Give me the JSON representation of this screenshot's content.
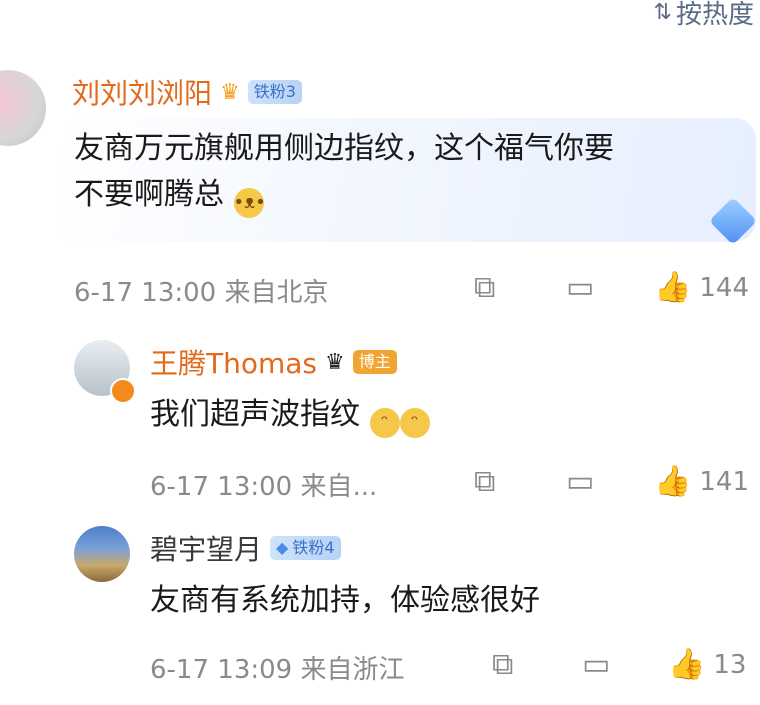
{
  "sort": {
    "icon": "sort-icon",
    "label": "按热度"
  },
  "comments": [
    {
      "name": "刘刘刘浏阳",
      "badge": "铁粉3",
      "text_line1": "友商万元旗舰用侧边指纹，这个福气你要",
      "text_line2": "不要啊腾总",
      "time": "6-17 13:00",
      "location": "来自北京",
      "likes": "144"
    },
    {
      "name": "王腾Thomas",
      "badge": "博主",
      "text": "我们超声波指纹",
      "time": "6-17 13:00",
      "location": "来自...",
      "likes": "141"
    },
    {
      "name": "碧宇望月",
      "badge": "铁粉4",
      "text": "友商有系统加持，体验感很好",
      "time": "6-17 13:09",
      "location": "来自浙江",
      "likes": "13"
    }
  ],
  "colors": {
    "username_highlight": "#e26a1a",
    "meta_gray": "#8a8a8a",
    "blogger_badge": "#f0a532"
  }
}
